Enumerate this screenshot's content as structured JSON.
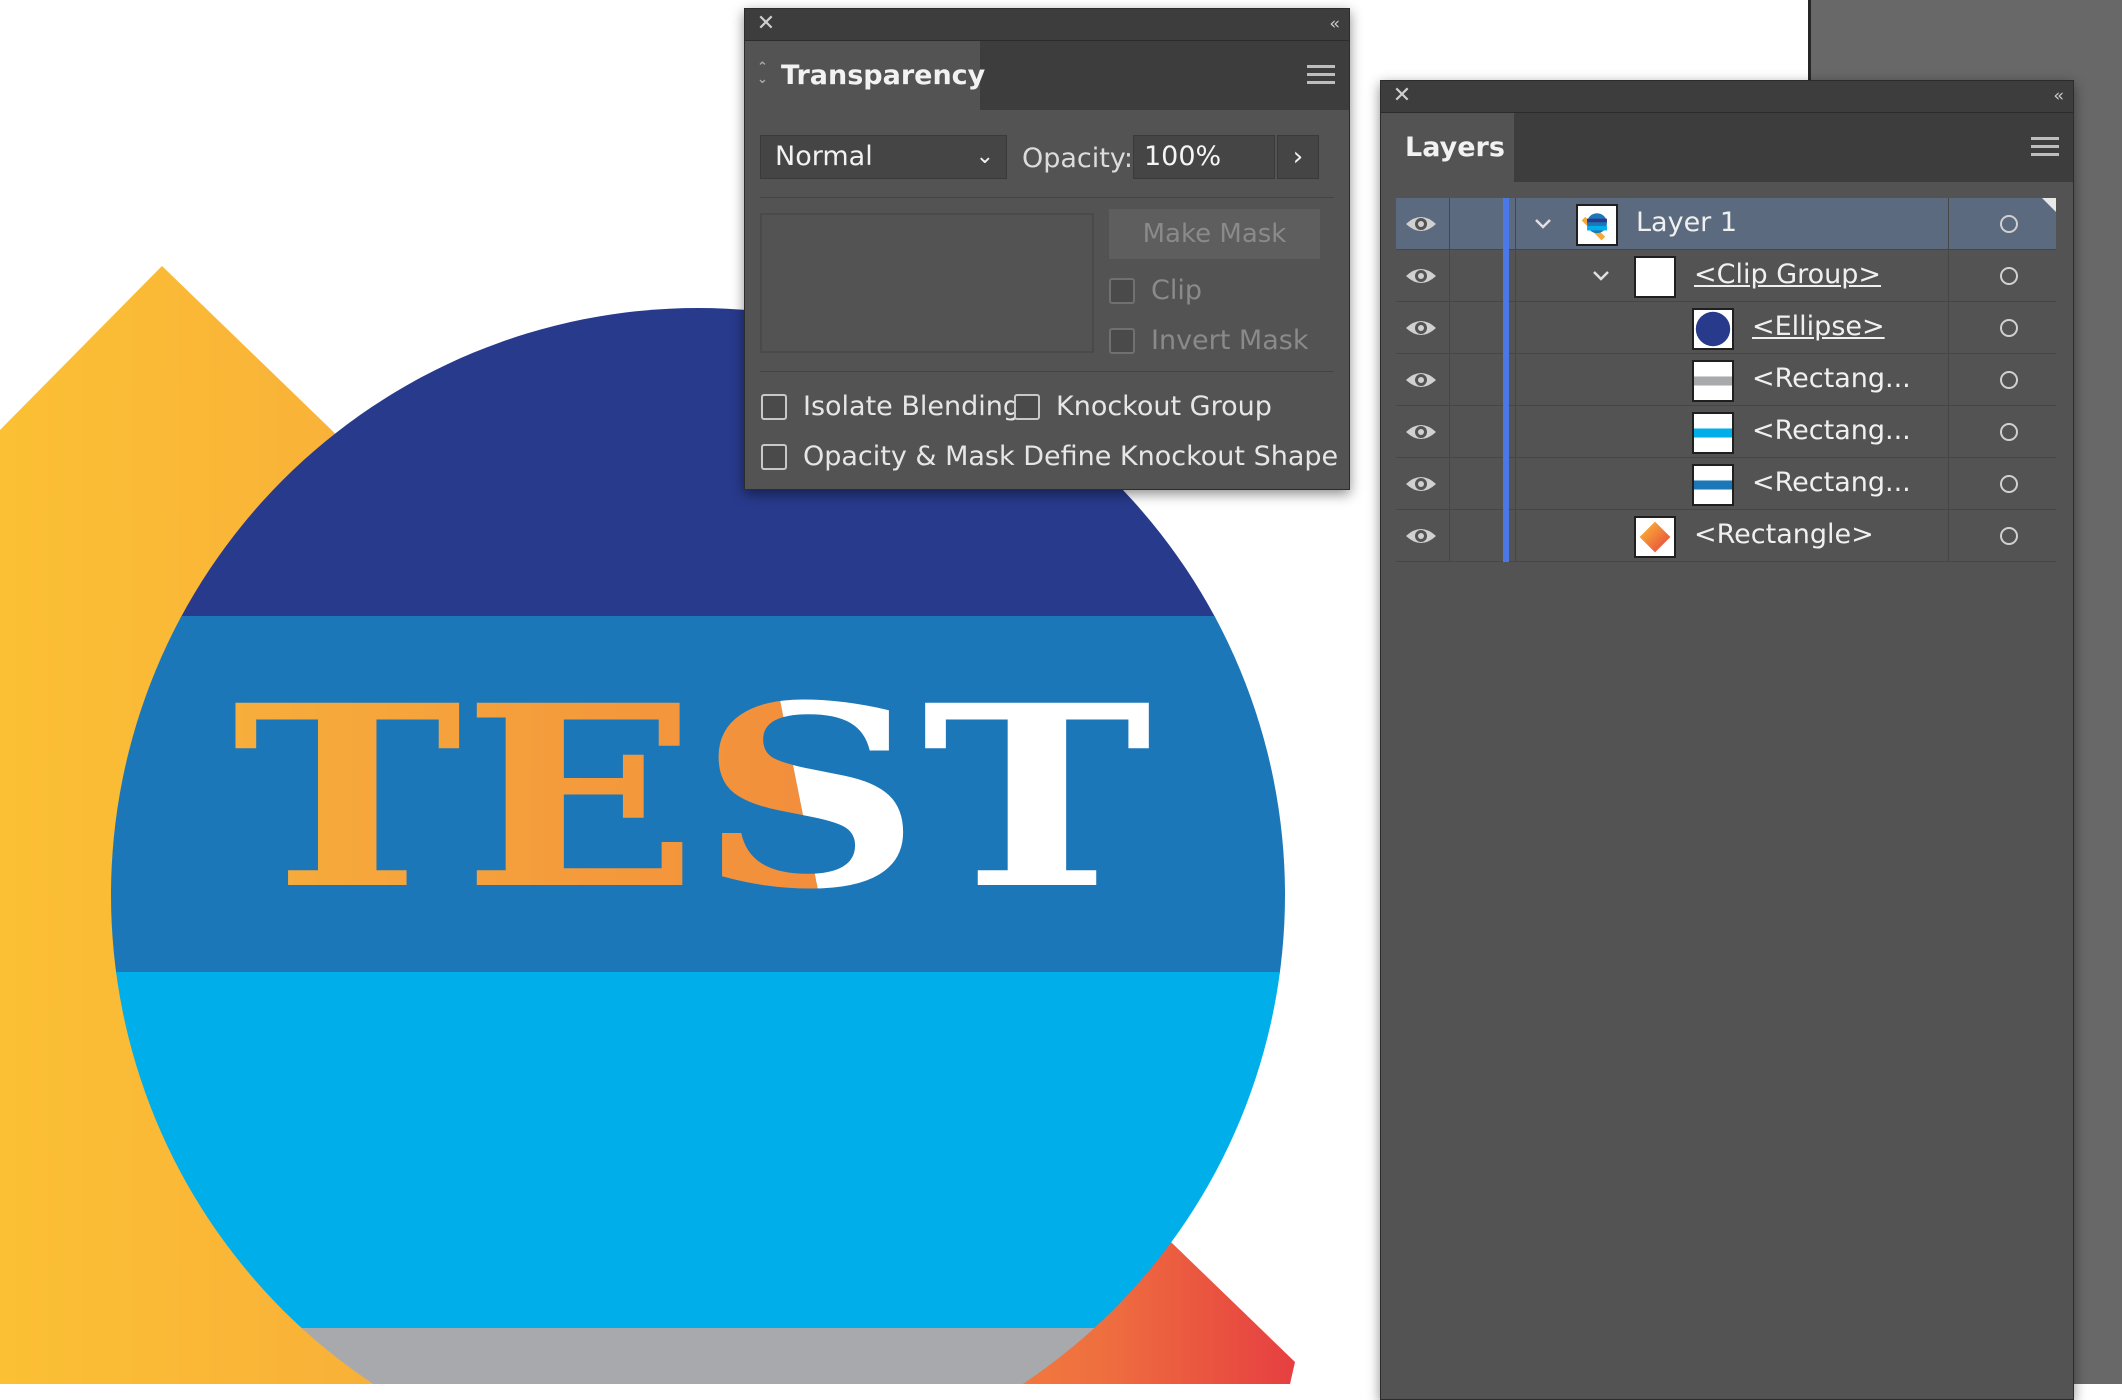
{
  "artwork": {
    "headline": "TEST"
  },
  "colors": {
    "panel_bg": "#535353",
    "panel_header": "#3d3d3d",
    "selection": "#5b6a7f",
    "layer_color": "#4a78e8",
    "navy": "#283a8c",
    "mid_blue": "#1c77b9",
    "light_blue": "#00aeea",
    "grey_band": "#a7a9ac",
    "orange": "#f5a53f"
  },
  "transparency": {
    "title": "Transparency",
    "blend_mode": "Normal",
    "opacity_label": "Opacity:",
    "opacity_value": "100%",
    "make_mask_label": "Make Mask",
    "clip_label": "Clip",
    "invert_mask_label": "Invert Mask",
    "isolate_blending_label": "Isolate Blending",
    "knockout_group_label": "Knockout Group",
    "opacity_mask_knockout_label": "Opacity & Mask Define Knockout Shape"
  },
  "layers": {
    "title": "Layers",
    "rows": [
      {
        "name": "Layer 1",
        "thumb": "layer",
        "selected": true
      },
      {
        "name": "<Clip Group>",
        "thumb": "clip"
      },
      {
        "name": "<Ellipse>",
        "thumb": "ellipse"
      },
      {
        "name": "<Rectang...",
        "thumb": "rect-grey"
      },
      {
        "name": "<Rectang...",
        "thumb": "rect-lightblue"
      },
      {
        "name": "<Rectang...",
        "thumb": "rect-blue"
      },
      {
        "name": "<Rectangle>",
        "thumb": "rect-gradient"
      }
    ]
  }
}
